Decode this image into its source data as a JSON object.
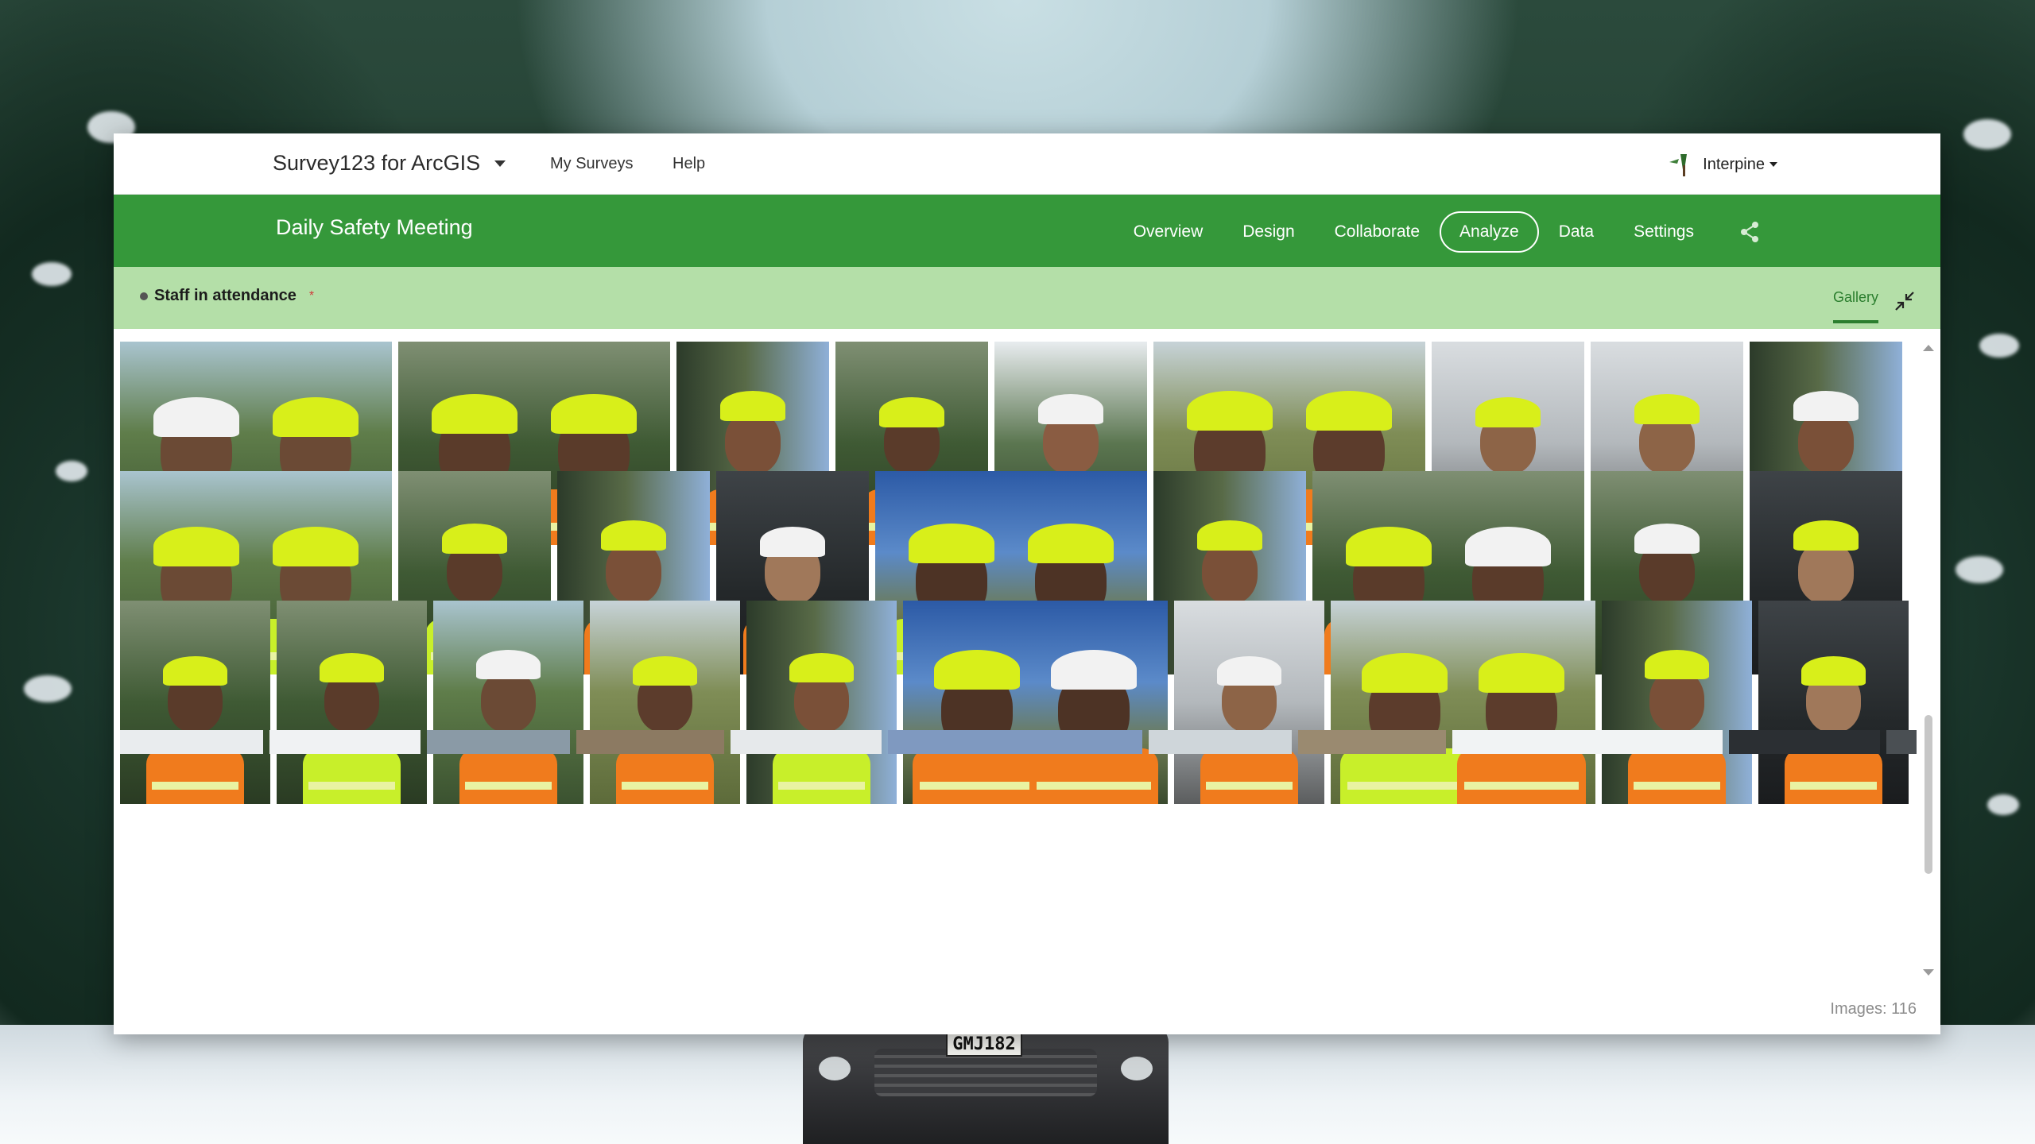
{
  "app": {
    "brand": "Survey123 for ArcGIS",
    "nav": [
      "My Surveys",
      "Help"
    ],
    "user": "Interpine"
  },
  "survey": {
    "title": "Daily Safety Meeting",
    "tabs": [
      {
        "label": "Overview",
        "active": false
      },
      {
        "label": "Design",
        "active": false
      },
      {
        "label": "Collaborate",
        "active": false
      },
      {
        "label": "Analyze",
        "active": true
      },
      {
        "label": "Data",
        "active": false
      },
      {
        "label": "Settings",
        "active": false
      }
    ]
  },
  "field": {
    "label": "Staff in attendance",
    "required_marker": "*",
    "view_tab": "Gallery"
  },
  "gallery": {
    "images_label": "Images: 116",
    "rows": [
      [
        {
          "w": 210,
          "tone": "sunny"
        },
        {
          "w": 210,
          "tone": "forest"
        },
        {
          "w": 118,
          "tone": "tilted"
        },
        {
          "w": 118,
          "tone": "forest"
        },
        {
          "w": 118,
          "tone": "bright"
        },
        {
          "w": 210,
          "tone": "field"
        },
        {
          "w": 118,
          "tone": "indoor"
        },
        {
          "w": 118,
          "tone": "indoor"
        },
        {
          "w": 118,
          "tone": "tilted"
        }
      ],
      [
        {
          "w": 210,
          "tone": "sunny"
        },
        {
          "w": 118,
          "tone": "forest"
        },
        {
          "w": 118,
          "tone": "tilted"
        },
        {
          "w": 118,
          "tone": "car"
        },
        {
          "w": 210,
          "tone": "blue"
        },
        {
          "w": 118,
          "tone": "tilted"
        },
        {
          "w": 210,
          "tone": "forest"
        },
        {
          "w": 118,
          "tone": "forest"
        },
        {
          "w": 118,
          "tone": "car"
        }
      ],
      [
        {
          "w": 116,
          "tone": "forest"
        },
        {
          "w": 116,
          "tone": "forest"
        },
        {
          "w": 116,
          "tone": "sunny"
        },
        {
          "w": 116,
          "tone": "field"
        },
        {
          "w": 116,
          "tone": "tilted"
        },
        {
          "w": 204,
          "tone": "blue"
        },
        {
          "w": 116,
          "tone": "indoor"
        },
        {
          "w": 204,
          "tone": "field"
        },
        {
          "w": 116,
          "tone": "tilted"
        },
        {
          "w": 116,
          "tone": "car"
        }
      ]
    ]
  },
  "colors": {
    "brand_green": "#35983a",
    "subbar_green": "#b4dfa8",
    "gallery_accent": "#2b7e2e",
    "hi_vis_yellow": "#d8ef1a",
    "vest_orange": "#f07b1d"
  },
  "icons": {
    "brand_menu": "chevron-down-icon",
    "share": "share-icon",
    "collapse": "collapse-icon",
    "user_logo": "tree-logo-icon"
  },
  "background": {
    "plate": "GMJ182"
  }
}
